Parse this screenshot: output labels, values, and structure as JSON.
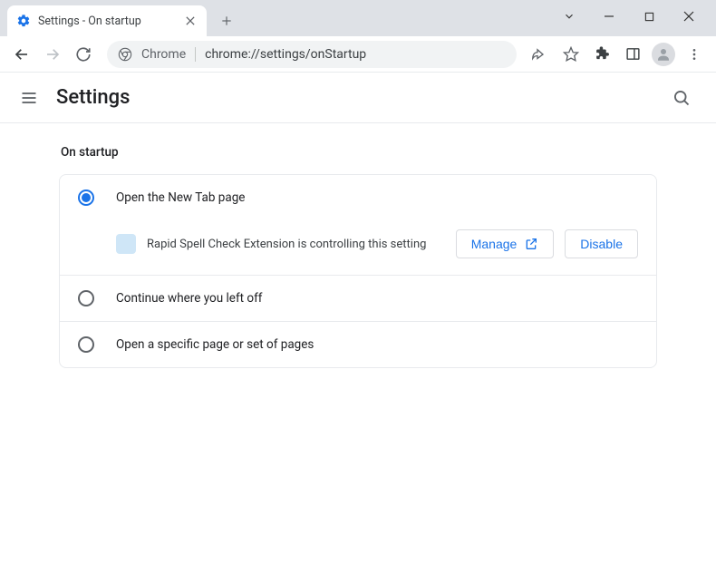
{
  "window": {
    "tab_title": "Settings - On startup"
  },
  "omnibox": {
    "scheme_label": "Chrome",
    "url": "chrome://settings/onStartup"
  },
  "header": {
    "title": "Settings"
  },
  "section": {
    "title": "On startup",
    "options": [
      {
        "label": "Open the New Tab page",
        "selected": true
      },
      {
        "label": "Continue where you left off",
        "selected": false
      },
      {
        "label": "Open a specific page or set of pages",
        "selected": false
      }
    ],
    "extension_notice": {
      "text": "Rapid Spell Check Extension is controlling this setting",
      "manage_label": "Manage",
      "disable_label": "Disable"
    }
  }
}
